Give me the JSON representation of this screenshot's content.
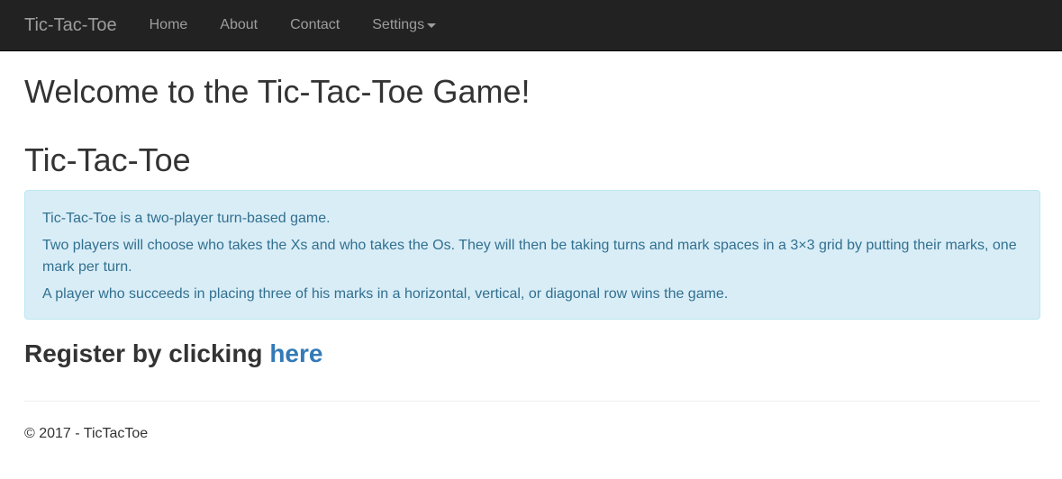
{
  "navbar": {
    "brand": "Tic-Tac-Toe",
    "items": [
      {
        "label": "Home"
      },
      {
        "label": "About"
      },
      {
        "label": "Contact"
      },
      {
        "label": "Settings",
        "icon": "caret-down-icon"
      }
    ]
  },
  "main": {
    "welcome_heading": "Welcome to the Tic-Tac-Toe Game!",
    "game_heading": "Tic-Tac-Toe",
    "info": {
      "paragraphs": [
        "Tic-Tac-Toe is a two-player turn-based game.",
        "Two players will choose who takes the Xs and who takes the Os. They will then be taking turns and mark spaces in a 3×3 grid by putting their marks, one mark per turn.",
        "A player who succeeds in placing three of his marks in a horizontal, vertical, or diagonal row wins the game."
      ]
    },
    "register": {
      "prefix": "Register by clicking ",
      "link_text": "here"
    }
  },
  "footer": {
    "text": "© 2017 - TicTacToe"
  },
  "colors": {
    "navbar_bg": "#222222",
    "nav_text": "#9d9d9d",
    "info_bg": "#d9edf7",
    "info_text": "#31708f",
    "link": "#337ab7"
  }
}
